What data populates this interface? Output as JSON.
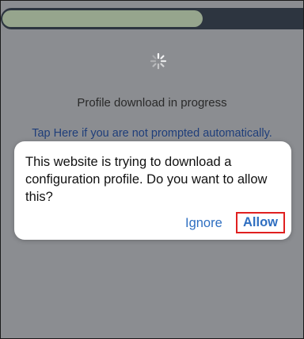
{
  "progress": {
    "value_percent": 67,
    "fill_color": "#96a58d",
    "track_color": "#2d3540"
  },
  "spinner": {
    "icon": "loading-spinner-icon"
  },
  "status": {
    "text": "Profile download in progress"
  },
  "link": {
    "text": "Tap Here if you are not prompted automatically."
  },
  "dialog": {
    "message": "This website is trying to download a configuration profile. Do you want to allow this?",
    "ignore_label": "Ignore",
    "allow_label": "Allow",
    "highlight_color": "#e02020"
  }
}
